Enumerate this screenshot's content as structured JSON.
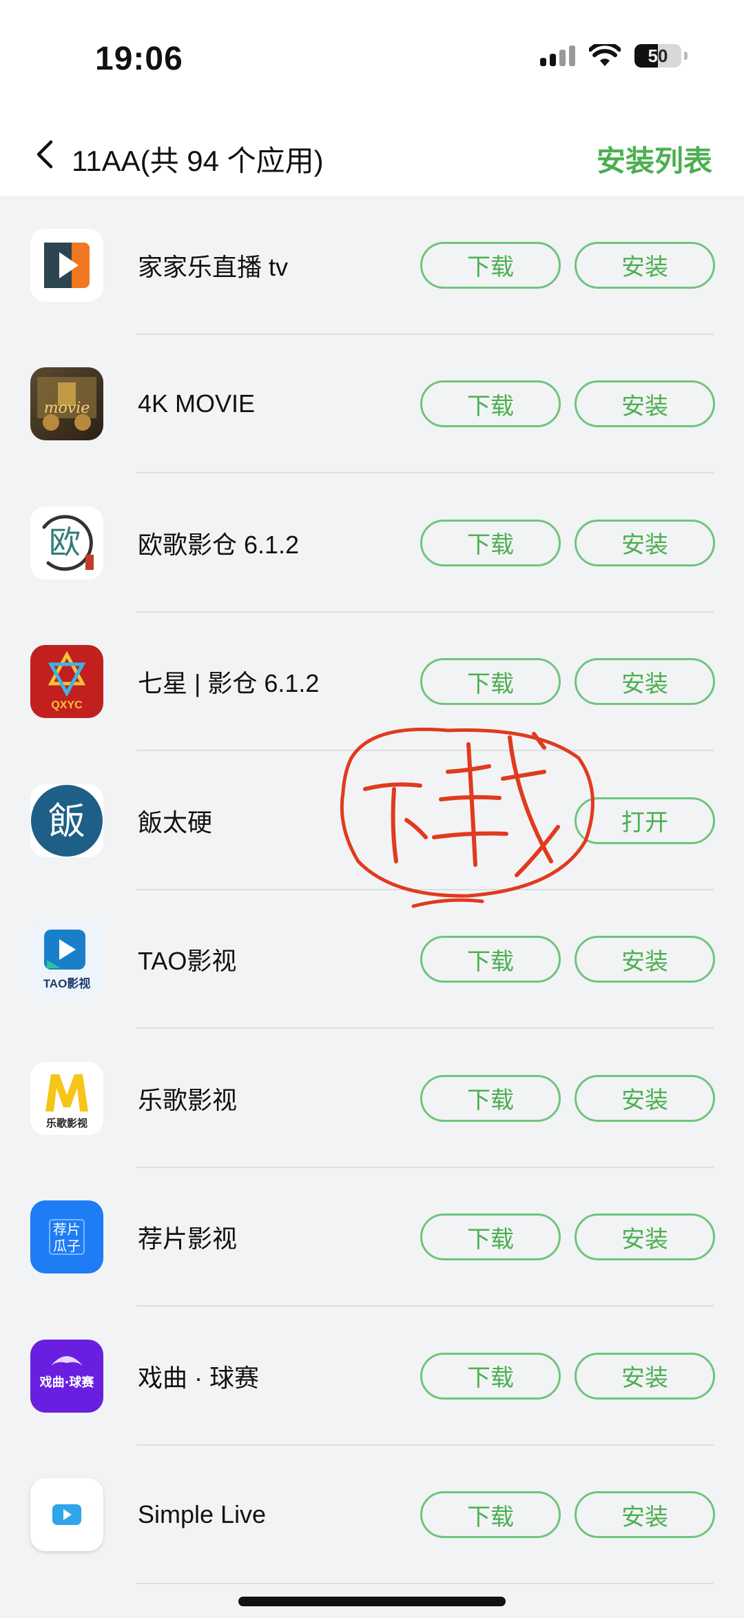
{
  "status_bar": {
    "time": "19:06",
    "battery": "50"
  },
  "header": {
    "back_icon": "chevron-left-icon",
    "title": "11AA(共 94 个应用)",
    "action": "安装列表"
  },
  "colors": {
    "accent": "#4caf50",
    "annotation": "#e03a1f"
  },
  "apps": [
    {
      "name": "家家乐直播 tv",
      "icon": "play-icon",
      "download": "下载",
      "install": "安装"
    },
    {
      "name": "4K MOVIE",
      "icon": "movie-icon",
      "download": "下载",
      "install": "安装"
    },
    {
      "name": "欧歌影仓 6.1.2",
      "icon": "ouge-icon",
      "icon_text": "欧",
      "download": "下载",
      "install": "安装"
    },
    {
      "name": "七星 | 影仓 6.1.2",
      "icon": "star-icon",
      "icon_text": "QXYC",
      "download": "下载",
      "install": "安装"
    },
    {
      "name": "飯太硬",
      "icon": "fan-icon",
      "icon_text": "飯",
      "open": "打开"
    },
    {
      "name": "TAO影视",
      "icon": "tao-icon",
      "icon_text": "TAO影视",
      "download": "下载",
      "install": "安装"
    },
    {
      "name": "乐歌影视",
      "icon": "lege-icon",
      "icon_text": "乐歌影视",
      "download": "下载",
      "install": "安装"
    },
    {
      "name": "荐片影视",
      "icon": "jianpian-icon",
      "icon_text": "荐片 瓜子",
      "download": "下载",
      "install": "安装"
    },
    {
      "name": "戏曲 · 球赛",
      "icon": "opera-icon",
      "icon_text": "戏曲·球赛",
      "download": "下载",
      "install": "安装"
    },
    {
      "name": "Simple Live",
      "icon": "simple-live-icon",
      "download": "下载",
      "install": "安装"
    }
  ],
  "annotation_text": "下载"
}
